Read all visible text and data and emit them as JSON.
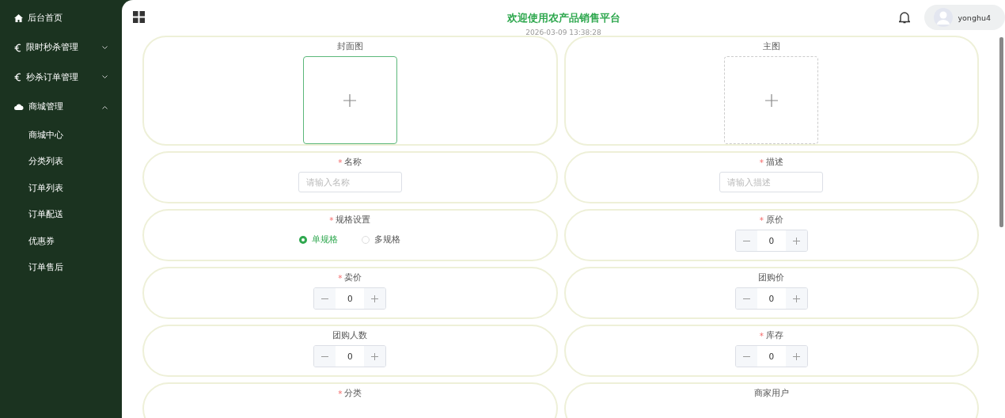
{
  "sidebar": {
    "items": [
      {
        "label": "后台首页"
      },
      {
        "label": "限时秒杀管理",
        "expanded": false
      },
      {
        "label": "秒杀订单管理",
        "expanded": false
      },
      {
        "label": "商城管理",
        "expanded": true,
        "children": [
          {
            "label": "商城中心"
          },
          {
            "label": "分类列表"
          },
          {
            "label": "订单列表"
          },
          {
            "label": "订单配送"
          },
          {
            "label": "优惠券"
          },
          {
            "label": "订单售后"
          }
        ]
      }
    ]
  },
  "header": {
    "title": "欢迎使用农产品销售平台",
    "datetime": "2026-03-09 13:38:28",
    "user": "yonghu4"
  },
  "form": {
    "fields": [
      {
        "kind": "upload",
        "label": "封面图",
        "selected": true
      },
      {
        "kind": "upload",
        "label": "主图",
        "selected": false
      },
      {
        "kind": "text",
        "label": "名称",
        "mark": "*",
        "placeholder": "请输入名称"
      },
      {
        "kind": "text",
        "label": "描述",
        "mark": "*",
        "placeholder": "请输入描述"
      },
      {
        "kind": "radio",
        "label": "规格设置",
        "mark": "*",
        "options": [
          {
            "label": "单规格",
            "selected": true
          },
          {
            "label": "多规格",
            "selected": false
          }
        ]
      },
      {
        "kind": "number",
        "label": "原价",
        "mark": "*",
        "value": "0"
      },
      {
        "kind": "number",
        "label": "卖价",
        "mark": "*",
        "value": "0"
      },
      {
        "kind": "number",
        "label": "团购价",
        "value": "0"
      },
      {
        "kind": "number",
        "label": "团购人数",
        "value": "0"
      },
      {
        "kind": "number",
        "label": "库存",
        "mark": "*",
        "value": "0"
      },
      {
        "kind": "label",
        "label": "分类",
        "mark": "*"
      },
      {
        "kind": "label",
        "label": "商家用户"
      }
    ]
  }
}
